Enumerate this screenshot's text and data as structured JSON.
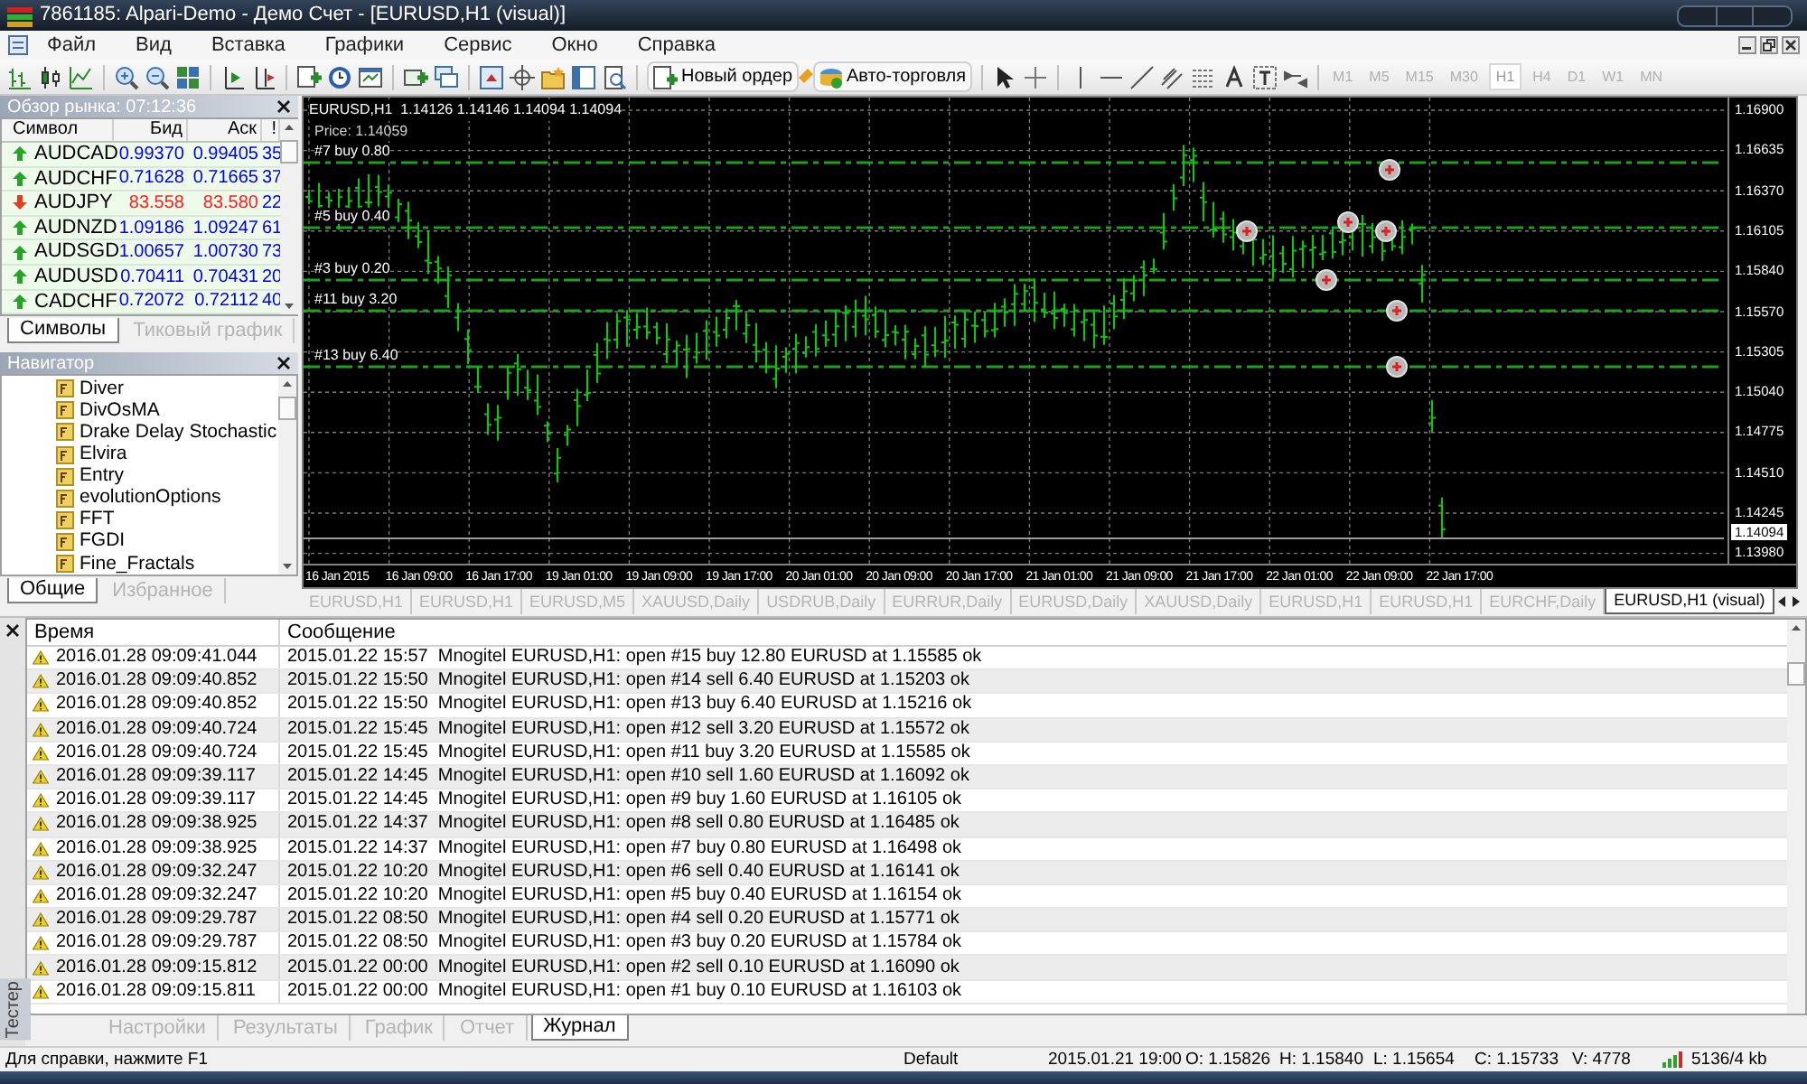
{
  "window": {
    "title": "7861185: Alpari-Demo - Демо Счет - [EURUSD,H1 (visual)]"
  },
  "menu": [
    "Файл",
    "Вид",
    "Вставка",
    "Графики",
    "Сервис",
    "Окно",
    "Справка"
  ],
  "toolbar": {
    "buttons": [
      "Новый ордер",
      "Авто-торговля"
    ],
    "timeframes": [
      {
        "label": "M1",
        "selected": false
      },
      {
        "label": "M5",
        "selected": false
      },
      {
        "label": "M15",
        "selected": false
      },
      {
        "label": "M30",
        "selected": false
      },
      {
        "label": "H1",
        "selected": true
      },
      {
        "label": "H4",
        "selected": false
      },
      {
        "label": "D1",
        "selected": false
      },
      {
        "label": "W1",
        "selected": false
      },
      {
        "label": "MN",
        "selected": false
      }
    ]
  },
  "market_watch": {
    "title": "Обзор рынка: 07:12:36",
    "columns": [
      "Символ",
      "Бид",
      "Аск",
      "!"
    ],
    "rows": [
      {
        "symbol": "AUDCAD",
        "bid": "0.99370",
        "ask": "0.99405",
        "spread": "35",
        "rising": true
      },
      {
        "symbol": "AUDCHF",
        "bid": "0.71628",
        "ask": "0.71665",
        "spread": "37",
        "rising": true
      },
      {
        "symbol": "AUDJPY",
        "bid": "83.558",
        "ask": "83.580",
        "spread": "22",
        "rising": false
      },
      {
        "symbol": "AUDNZD",
        "bid": "1.09186",
        "ask": "1.09247",
        "spread": "61",
        "rising": true
      },
      {
        "symbol": "AUDSGD",
        "bid": "1.00657",
        "ask": "1.00730",
        "spread": "73",
        "rising": true
      },
      {
        "symbol": "AUDUSD",
        "bid": "0.70411",
        "ask": "0.70431",
        "spread": "20",
        "rising": true
      },
      {
        "symbol": "CADCHF",
        "bid": "0.72072",
        "ask": "0.72112",
        "spread": "40",
        "rising": true
      }
    ],
    "tabs": [
      {
        "label": "Символы",
        "selected": true
      },
      {
        "label": "Тиковый график",
        "selected": false
      }
    ]
  },
  "navigator": {
    "title": "Навигатор",
    "items": [
      "Diver",
      "DivOsMA",
      "Drake Delay Stochastic",
      "Elvira",
      "Entry",
      "evolutionOptions",
      "FFT",
      "FGDI",
      "Fine_Fractals"
    ],
    "tabs": [
      {
        "label": "Общие",
        "selected": true
      },
      {
        "label": "Избранное",
        "selected": false
      }
    ]
  },
  "chart": {
    "header": "EURUSD,H1  1.14126 1.14146 1.14094 1.14094",
    "price_info": "Price: 1.14059",
    "orders": [
      "#7 buy 0.80",
      "#5 buy 0.40",
      "#3 buy 0.20",
      "#11 buy 3.20",
      "#13 buy 6.40"
    ],
    "price_labels": [
      "1.16900",
      "1.16635",
      "1.16370",
      "1.16105",
      "1.15840",
      "1.15570",
      "1.15305",
      "1.15040",
      "1.14775",
      "1.14510",
      "1.14245",
      "1.13980"
    ],
    "current_price": "1.14094",
    "time_labels": [
      "16 Jan 2015",
      "16 Jan 09:00",
      "16 Jan 17:00",
      "19 Jan 01:00",
      "19 Jan 09:00",
      "19 Jan 17:00",
      "20 Jan 01:00",
      "20 Jan 09:00",
      "20 Jan 17:00",
      "21 Jan 01:00",
      "21 Jan 09:00",
      "21 Jan 17:00",
      "22 Jan 01:00",
      "22 Jan 09:00",
      "22 Jan 17:00"
    ]
  },
  "chart_tabs": [
    {
      "label": "EURUSD,H1",
      "selected": false
    },
    {
      "label": "EURUSD,H1",
      "selected": false
    },
    {
      "label": "EURUSD,M5",
      "selected": false
    },
    {
      "label": "XAUUSD,Daily",
      "selected": false
    },
    {
      "label": "USDRUB,Daily",
      "selected": false
    },
    {
      "label": "EURRUR,Daily",
      "selected": false
    },
    {
      "label": "EURUSD,Daily",
      "selected": false
    },
    {
      "label": "XAUUSD,Daily",
      "selected": false
    },
    {
      "label": "EURUSD,H1",
      "selected": false
    },
    {
      "label": "EURUSD,H1",
      "selected": false
    },
    {
      "label": "EURCHF,Daily",
      "selected": false
    },
    {
      "label": "EURUSD,H1 (visual)",
      "selected": true
    }
  ],
  "tester": {
    "side_label": "Тестер",
    "columns": [
      "Время",
      "Сообщение"
    ],
    "rows": [
      {
        "time": "2016.01.28 09:09:41.044",
        "message": "2015.01.22 15:57  Mnogitel EURUSD,H1: open #15 buy 12.80 EURUSD at 1.15585 ok"
      },
      {
        "time": "2016.01.28 09:09:40.852",
        "message": "2015.01.22 15:50  Mnogitel EURUSD,H1: open #14 sell 6.40 EURUSD at 1.15203 ok"
      },
      {
        "time": "2016.01.28 09:09:40.852",
        "message": "2015.01.22 15:50  Mnogitel EURUSD,H1: open #13 buy 6.40 EURUSD at 1.15216 ok"
      },
      {
        "time": "2016.01.28 09:09:40.724",
        "message": "2015.01.22 15:45  Mnogitel EURUSD,H1: open #12 sell 3.20 EURUSD at 1.15572 ok"
      },
      {
        "time": "2016.01.28 09:09:40.724",
        "message": "2015.01.22 15:45  Mnogitel EURUSD,H1: open #11 buy 3.20 EURUSD at 1.15585 ok"
      },
      {
        "time": "2016.01.28 09:09:39.117",
        "message": "2015.01.22 14:45  Mnogitel EURUSD,H1: open #10 sell 1.60 EURUSD at 1.16092 ok"
      },
      {
        "time": "2016.01.28 09:09:39.117",
        "message": "2015.01.22 14:45  Mnogitel EURUSD,H1: open #9 buy 1.60 EURUSD at 1.16105 ok"
      },
      {
        "time": "2016.01.28 09:09:38.925",
        "message": "2015.01.22 14:37  Mnogitel EURUSD,H1: open #8 sell 0.80 EURUSD at 1.16485 ok"
      },
      {
        "time": "2016.01.28 09:09:38.925",
        "message": "2015.01.22 14:37  Mnogitel EURUSD,H1: open #7 buy 0.80 EURUSD at 1.16498 ok"
      },
      {
        "time": "2016.01.28 09:09:32.247",
        "message": "2015.01.22 10:20  Mnogitel EURUSD,H1: open #6 sell 0.40 EURUSD at 1.16141 ok"
      },
      {
        "time": "2016.01.28 09:09:32.247",
        "message": "2015.01.22 10:20  Mnogitel EURUSD,H1: open #5 buy 0.40 EURUSD at 1.16154 ok"
      },
      {
        "time": "2016.01.28 09:09:29.787",
        "message": "2015.01.22 08:50  Mnogitel EURUSD,H1: open #4 sell 0.20 EURUSD at 1.15771 ok"
      },
      {
        "time": "2016.01.28 09:09:29.787",
        "message": "2015.01.22 08:50  Mnogitel EURUSD,H1: open #3 buy 0.20 EURUSD at 1.15784 ok"
      },
      {
        "time": "2016.01.28 09:09:15.812",
        "message": "2015.01.22 00:00  Mnogitel EURUSD,H1: open #2 sell 0.10 EURUSD at 1.16090 ok"
      },
      {
        "time": "2016.01.28 09:09:15.811",
        "message": "2015.01.22 00:00  Mnogitel EURUSD,H1: open #1 buy 0.10 EURUSD at 1.16103 ok"
      }
    ],
    "tabs": [
      {
        "label": "Настройки",
        "selected": false
      },
      {
        "label": "Результаты",
        "selected": false
      },
      {
        "label": "График",
        "selected": false
      },
      {
        "label": "Отчет",
        "selected": false
      },
      {
        "label": "Журнал",
        "selected": true
      }
    ]
  },
  "status_bar": [
    "Для справки, нажмите F1",
    "Default",
    "2015.01.21 19:00",
    "O: 1.15826",
    "H: 1.15840",
    "L: 1.15654",
    "C: 1.15733",
    "V: 4778",
    "5136/4 kb"
  ]
}
